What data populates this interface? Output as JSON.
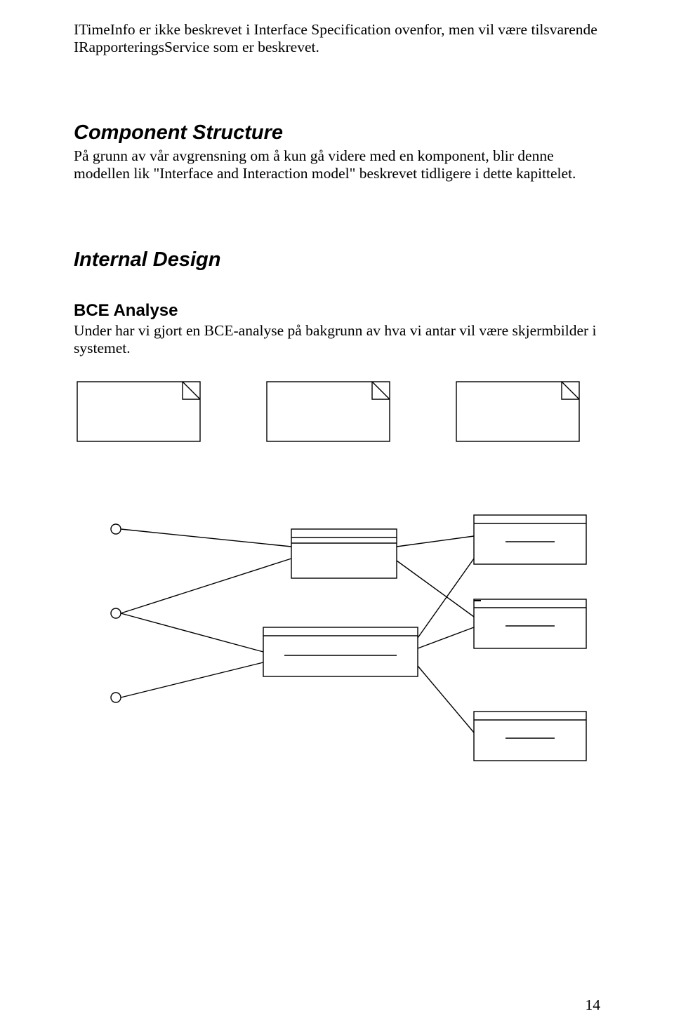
{
  "paragraphs": {
    "p1": "ITimeInfo er ikke beskrevet i Interface Specification ovenfor, men vil være tilsvarende IRapporteringsService som er beskrevet.",
    "p2": "På grunn av vår avgrensning om å kun gå videre med en komponent, blir denne modellen lik \"Interface and Interaction model\" beskrevet tidligere i dette kapittelet.",
    "p3": "Under har vi gjort en BCE-analyse på bakgrunn av hva vi antar vil være skjermbilder i systemet."
  },
  "headings": {
    "h_component_structure": "Component Structure",
    "h_internal_design": "Internal Design",
    "h_bce": "BCE Analyse"
  },
  "page_number": "14"
}
